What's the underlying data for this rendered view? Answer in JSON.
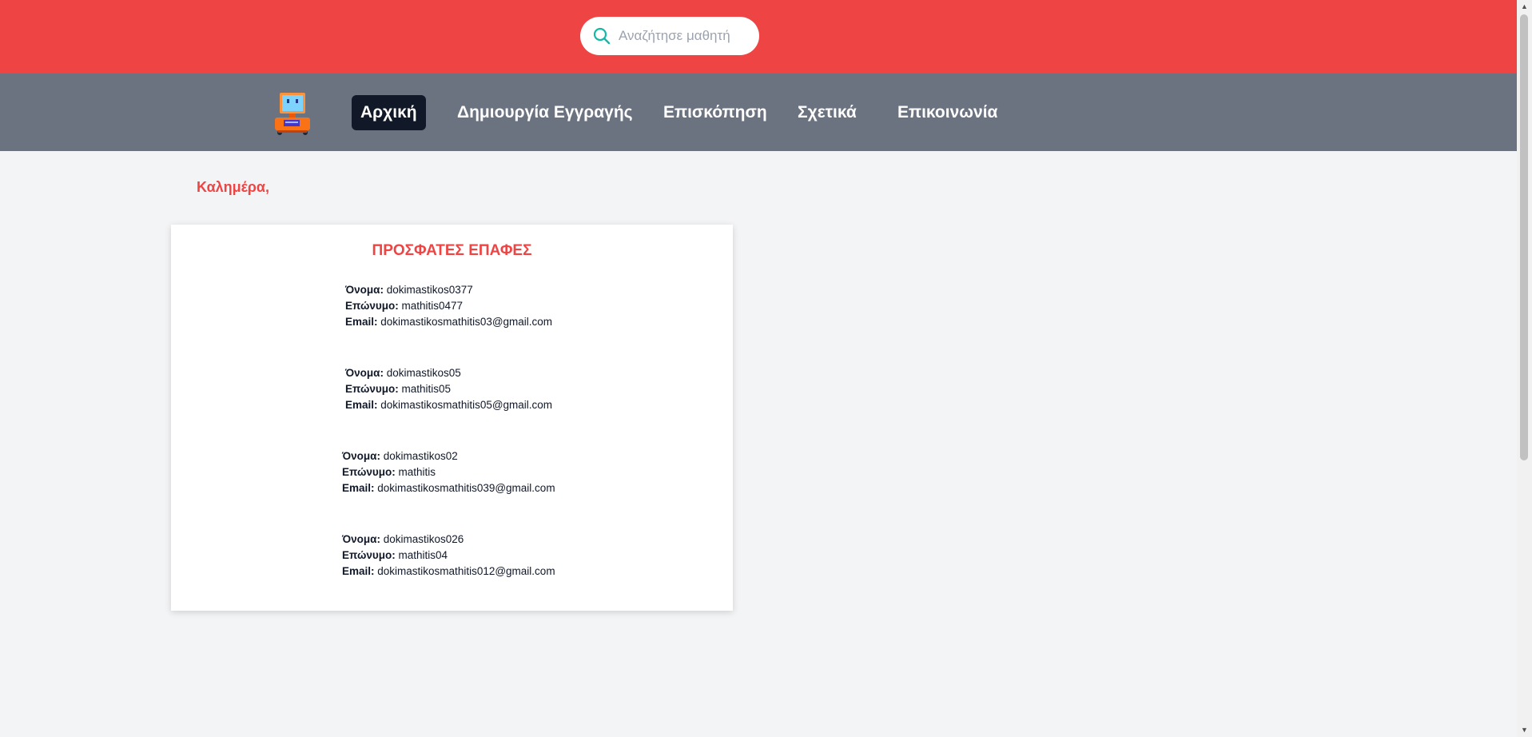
{
  "search": {
    "placeholder": "Αναζήτησε μαθητή",
    "value": "",
    "icon": "search-icon",
    "icon_color": "#14b8a6"
  },
  "colors": {
    "topbar": "#ef4444",
    "navbar": "#6b7280",
    "nav_active": "#111827",
    "accent": "#ef4444",
    "background": "#f3f4f6"
  },
  "nav": {
    "logo": "computer-logo-icon",
    "items": [
      {
        "label": "Αρχική",
        "active": true
      },
      {
        "label": "Δημιουργία Εγγραγής",
        "active": false
      },
      {
        "label": "Επισκόπηση",
        "active": false
      },
      {
        "label": "Σχετικά",
        "active": false
      },
      {
        "label": "Επικοινωνία",
        "active": false
      }
    ]
  },
  "main": {
    "greeting": "Καλημέρα,",
    "recent": {
      "title": "ΠΡΟΣΦΑΤΕΣ ΕΠΑΦΕΣ",
      "labels": {
        "first_name": "Όνομα:",
        "last_name": "Επώνυμο:",
        "email": "Email:"
      },
      "contacts": [
        {
          "first_name": "dokimastikos0377",
          "last_name": "mathitis0477",
          "email": "dokimastikosmathitis03@gmail.com"
        },
        {
          "first_name": "dokimastikos05",
          "last_name": "mathitis05",
          "email": "dokimastikosmathitis05@gmail.com"
        },
        {
          "first_name": "dokimastikos02",
          "last_name": "mathitis",
          "email": "dokimastikosmathitis039@gmail.com"
        },
        {
          "first_name": "dokimastikos026",
          "last_name": "mathitis04",
          "email": "dokimastikosmathitis012@gmail.com"
        }
      ]
    }
  },
  "scrollbar": {
    "up_arrow": "▲",
    "down_arrow": "▼"
  }
}
